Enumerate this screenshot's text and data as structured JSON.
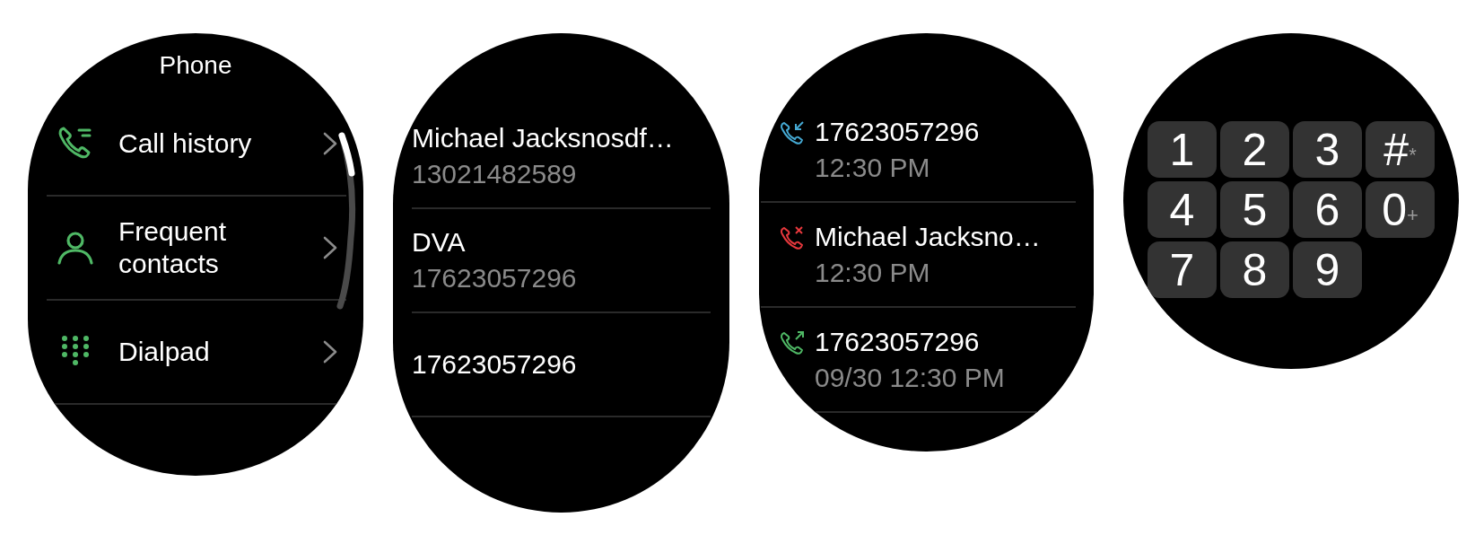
{
  "phone_menu": {
    "title": "Phone",
    "items": [
      {
        "label": "Call history",
        "kind": "history"
      },
      {
        "label": "Frequent contacts",
        "kind": "contacts"
      },
      {
        "label": "Dialpad",
        "kind": "dialpad"
      }
    ]
  },
  "contacts": [
    {
      "name": "Michael Jacksnosdf…",
      "number": "13021482589"
    },
    {
      "name": "DVA",
      "number": "17623057296"
    },
    {
      "name": "17623057296"
    }
  ],
  "call_log": [
    {
      "kind": "incoming",
      "caller": "17623057296",
      "time": "12:30 PM"
    },
    {
      "kind": "missed",
      "caller": "Michael Jacksno…",
      "time": "12:30 PM"
    },
    {
      "kind": "outgoing",
      "caller": "17623057296",
      "time": "09/30 12:30 PM"
    }
  ],
  "dialpad": {
    "keys": [
      {
        "label": "1"
      },
      {
        "label": "2"
      },
      {
        "label": "3"
      },
      {
        "label": "#",
        "sub": "*"
      },
      {
        "label": "4"
      },
      {
        "label": "5"
      },
      {
        "label": "6"
      },
      {
        "label": "0",
        "sub": "+"
      },
      {
        "label": "7"
      },
      {
        "label": "8"
      },
      {
        "label": "9"
      }
    ]
  }
}
